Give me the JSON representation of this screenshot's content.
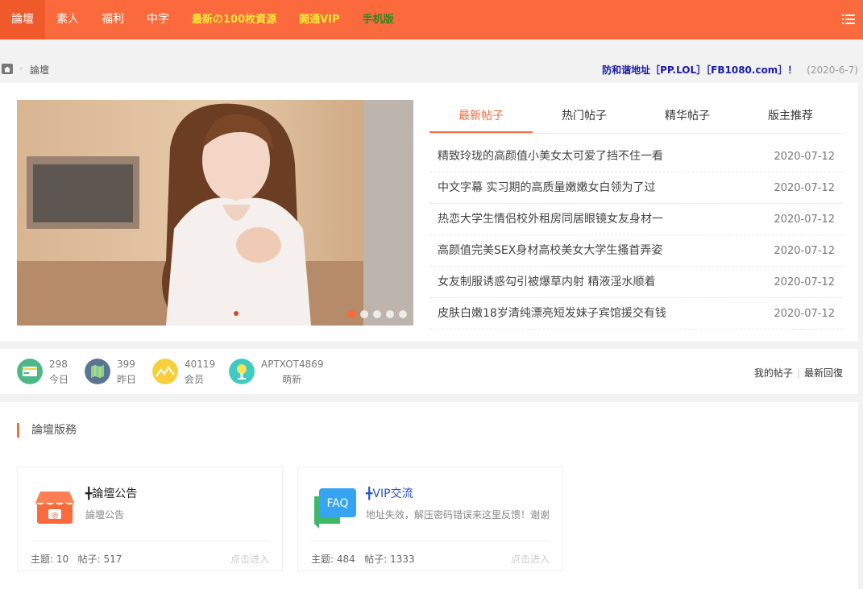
{
  "nav": {
    "items": [
      {
        "label": "論壇",
        "style": "active"
      },
      {
        "label": "素人",
        "style": ""
      },
      {
        "label": "福利",
        "style": ""
      },
      {
        "label": "中字",
        "style": ""
      },
      {
        "label": "最新の100枚資源",
        "style": "yellow"
      },
      {
        "label": "開通VIP",
        "style": "yellow"
      },
      {
        "label": "手机版",
        "style": "green"
      }
    ],
    "menu_icon": "list-icon"
  },
  "breadcrumb": {
    "home_icon": "home-icon",
    "current": "論壇"
  },
  "notice": {
    "text": "防和谐地址［PP.LOL］［FB1080.com］！",
    "date": "(2020-6-7)"
  },
  "slider": {
    "dots": 5,
    "active_index": 0
  },
  "tabs": [
    {
      "label": "最新帖子",
      "active": true
    },
    {
      "label": "热门帖子",
      "active": false
    },
    {
      "label": "精华帖子",
      "active": false
    },
    {
      "label": "版主推荐",
      "active": false
    }
  ],
  "posts": [
    {
      "title": "精致玲珑的高颜值小美女太可爱了挡不住一看",
      "date": "2020-07-12"
    },
    {
      "title": "中文字幕 实习期的高质量嫩嫩女白领为了过",
      "date": "2020-07-12"
    },
    {
      "title": "热恋大学生情侣校外租房同居眼镜女友身材一",
      "date": "2020-07-12"
    },
    {
      "title": "高颜值完美SEX身材高校美女大学生搔首弄姿",
      "date": "2020-07-12"
    },
    {
      "title": "女友制服诱惑勾引被爆草内射 精液淫水顺着",
      "date": "2020-07-12"
    },
    {
      "title": "皮肤白嫩18岁清纯漂亮短发妹子宾馆援交有钱",
      "date": "2020-07-12"
    }
  ],
  "stats": [
    {
      "value": "298",
      "label": "今日",
      "icon": "today-card-icon",
      "color": "#4cb885"
    },
    {
      "value": "399",
      "label": "昨日",
      "icon": "map-icon",
      "color": "#5a7590"
    },
    {
      "value": "40119",
      "label": "会员",
      "icon": "chart-icon",
      "color": "#f7cf3b"
    },
    {
      "value": "APTXOT4869",
      "label": "萌新",
      "icon": "microphone-icon",
      "color": "#3fcbc4"
    }
  ],
  "stat_links": {
    "my_posts": "我的帖子",
    "latest_replies": "最新回復"
  },
  "forum": {
    "title": "論壇版務",
    "cards": [
      {
        "title": "╋論壇公告",
        "desc": "論壇公告",
        "topics_label": "主题: 10",
        "posts_label": "帖子: 517",
        "enter": "点击进入",
        "icon": "shop-icon"
      },
      {
        "title": "╋VIP交流",
        "desc": "地址失效，解压密码错误来这里反馈！谢谢",
        "topics_label": "主题: 484",
        "posts_label": "帖子: 1333",
        "enter": "点击进入",
        "icon": "faq-icon"
      }
    ]
  },
  "colors": {
    "brand": "#fb6a3c",
    "nav_yellow": "#ffe83a",
    "nav_green": "#2b8a1e",
    "notice_blue": "#1b1ba8"
  }
}
